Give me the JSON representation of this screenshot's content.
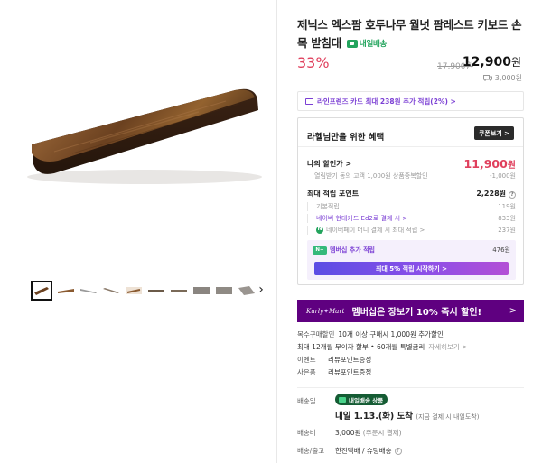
{
  "product": {
    "title": "제닉스 엑스팜 호두나무 월넛 팜레스트 키보드 손목 받침대",
    "next_day_badge": "내일배송",
    "discount": "33%",
    "original_price": "17,900원",
    "sale_price": "12,900",
    "sale_price_unit": "원",
    "shipping_fee": "3,000원"
  },
  "card_banner": {
    "text": "라인프렌즈 카드 최대 238원 추가 적립(2%) >"
  },
  "benefits": {
    "heading": "라헬님만을 위한 혜택",
    "coupon_button": "쿠폰보기 >",
    "my_price_label": "나의 할인가 >",
    "my_price_value": "11,900",
    "my_price_unit": "원",
    "same_day_label": "열림받기 동의 고객 1,000원 상품중복할인",
    "same_day_value": "-1,000원",
    "points_label": "최대 적립 포인트",
    "points_value": "2,228원",
    "points_help": "?",
    "basic_label": "기본적립",
    "basic_value": "119원",
    "naver_card_label": "네이버 현대카드 Ed2로 결제 시 >",
    "naver_card_value": "833원",
    "naver_pay_label": "네이버페이 머니 결제 시 최대 적립 >",
    "naver_pay_value": "237원",
    "member_chip": "N+",
    "member_label": "멤버십 추가 적립",
    "member_value": "476원",
    "member_button": "최대 5% 적립 시작하기 >"
  },
  "kurly_banner": {
    "logo_text": "Kurly",
    "logo_suffix": "Mart",
    "text": "멤버십은 장보기 10% 즉시 할인!",
    "arrow": ">"
  },
  "info": {
    "bulk_label": "복수구매할인",
    "bulk_value": "10개 이상 구매시 1,000원 추가할인",
    "installment_text": "최대 12개월 무이자 할부 • 60개월 특별금리",
    "installment_link": "자세히보기 >",
    "event_label": "이벤트",
    "event_value": "리뷰포인트증정",
    "gift_label": "사은품",
    "gift_value": "리뷰포인트증정"
  },
  "delivery": {
    "method_label": "배송일",
    "badge": "내일배송 상품",
    "date": "내일 1.13.(화) 도착",
    "date_note": "(지금 결제 시 내일도착)",
    "fee_label": "배송비",
    "fee_value": "3,000원",
    "fee_note": "(주문시 결제)",
    "carrier_label": "배송/출고",
    "carrier_value": "한진택배 / 슈팅배송",
    "carrier_help": "?"
  },
  "colors": {
    "discount": "#e0405d",
    "purple": "#7b3fd4",
    "kurly": "#5f0080",
    "wood_dark": "#3b2314",
    "wood_light": "#8a5a30"
  },
  "icons": [
    "card-icon",
    "truck-icon",
    "next-arrow-icon",
    "help-icon"
  ]
}
